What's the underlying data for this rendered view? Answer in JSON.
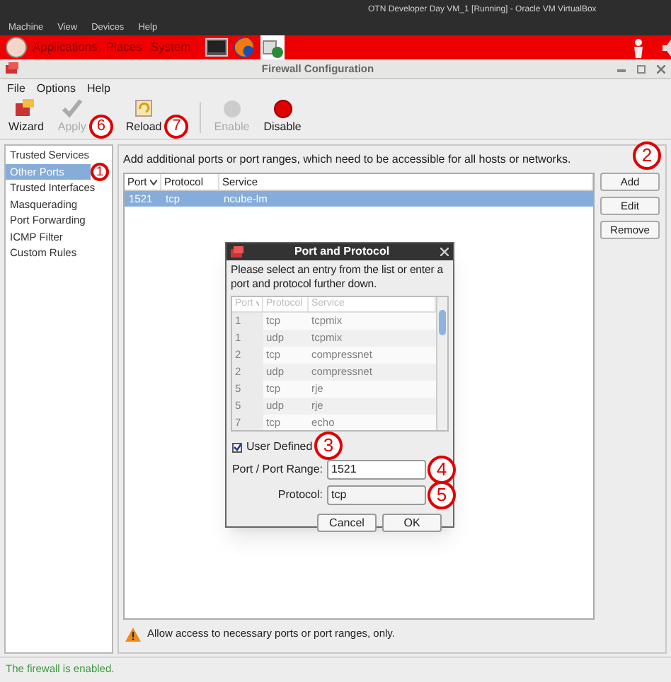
{
  "host_window": {
    "title": "OTN Developer Day VM_1 [Running] - Oracle VM VirtualBox",
    "menu": [
      "Machine",
      "View",
      "Devices",
      "Help"
    ]
  },
  "panel": {
    "menus": [
      "Applications",
      "Places",
      "System"
    ]
  },
  "window": {
    "title": "Firewall Configuration",
    "menu": [
      "File",
      "Options",
      "Help"
    ]
  },
  "toolbar": [
    {
      "kind": "wizard",
      "label": "Wizard",
      "disabled": false
    },
    {
      "kind": "apply",
      "label": "Apply",
      "disabled": true,
      "callout": "6"
    },
    {
      "kind": "reload",
      "label": "Reload",
      "disabled": false,
      "callout": "7"
    },
    {
      "kind": "enable",
      "label": "Enable",
      "disabled": true
    },
    {
      "kind": "disable",
      "label": "Disable",
      "disabled": false
    }
  ],
  "sidebar": {
    "items": [
      {
        "label": "Trusted Services",
        "selected": false
      },
      {
        "label": "Other Ports",
        "selected": true,
        "callout": "1"
      },
      {
        "label": "Trusted Interfaces",
        "selected": false
      },
      {
        "label": "Masquerading",
        "selected": false
      },
      {
        "label": "Port Forwarding",
        "selected": false
      },
      {
        "label": "ICMP Filter",
        "selected": false
      },
      {
        "label": "Custom Rules",
        "selected": false
      }
    ]
  },
  "main": {
    "description": "Add additional ports or port ranges, which need to be accessible for all hosts or networks.",
    "table": {
      "columns": [
        "Port",
        "Protocol",
        "Service"
      ],
      "rows": [
        {
          "cells": [
            "1521",
            "tcp",
            "ncube-lm"
          ],
          "selected": true
        }
      ]
    },
    "buttons": [
      {
        "label": "Add",
        "callout": "2"
      },
      {
        "label": "Edit"
      },
      {
        "label": "Remove"
      }
    ],
    "warning": "Allow access to necessary ports or port ranges, only."
  },
  "dialog": {
    "title": "Port and Protocol",
    "prompt": "Please select an entry from the list or enter a port and protocol further down.",
    "table": {
      "columns": [
        "Port",
        "Protocol",
        "Service"
      ],
      "rows": [
        {
          "cells": [
            "1",
            "tcp",
            "tcpmix"
          ]
        },
        {
          "cells": [
            "1",
            "udp",
            "tcpmix"
          ]
        },
        {
          "cells": [
            "2",
            "tcp",
            "compressnet"
          ]
        },
        {
          "cells": [
            "2",
            "udp",
            "compressnet"
          ]
        },
        {
          "cells": [
            "5",
            "tcp",
            "rje"
          ]
        },
        {
          "cells": [
            "5",
            "udp",
            "rje"
          ]
        },
        {
          "cells": [
            "7",
            "tcp",
            "echo"
          ]
        }
      ]
    },
    "user_defined": {
      "label": "User Defined",
      "checked": true,
      "callout": "3"
    },
    "port_field": {
      "label": "Port / Port Range:",
      "value": "1521",
      "callout": "4"
    },
    "protocol_field": {
      "label": "Protocol:",
      "value": "tcp",
      "callout": "5"
    },
    "buttons": [
      "Cancel",
      "OK"
    ]
  },
  "status_bar": "The firewall is enabled."
}
